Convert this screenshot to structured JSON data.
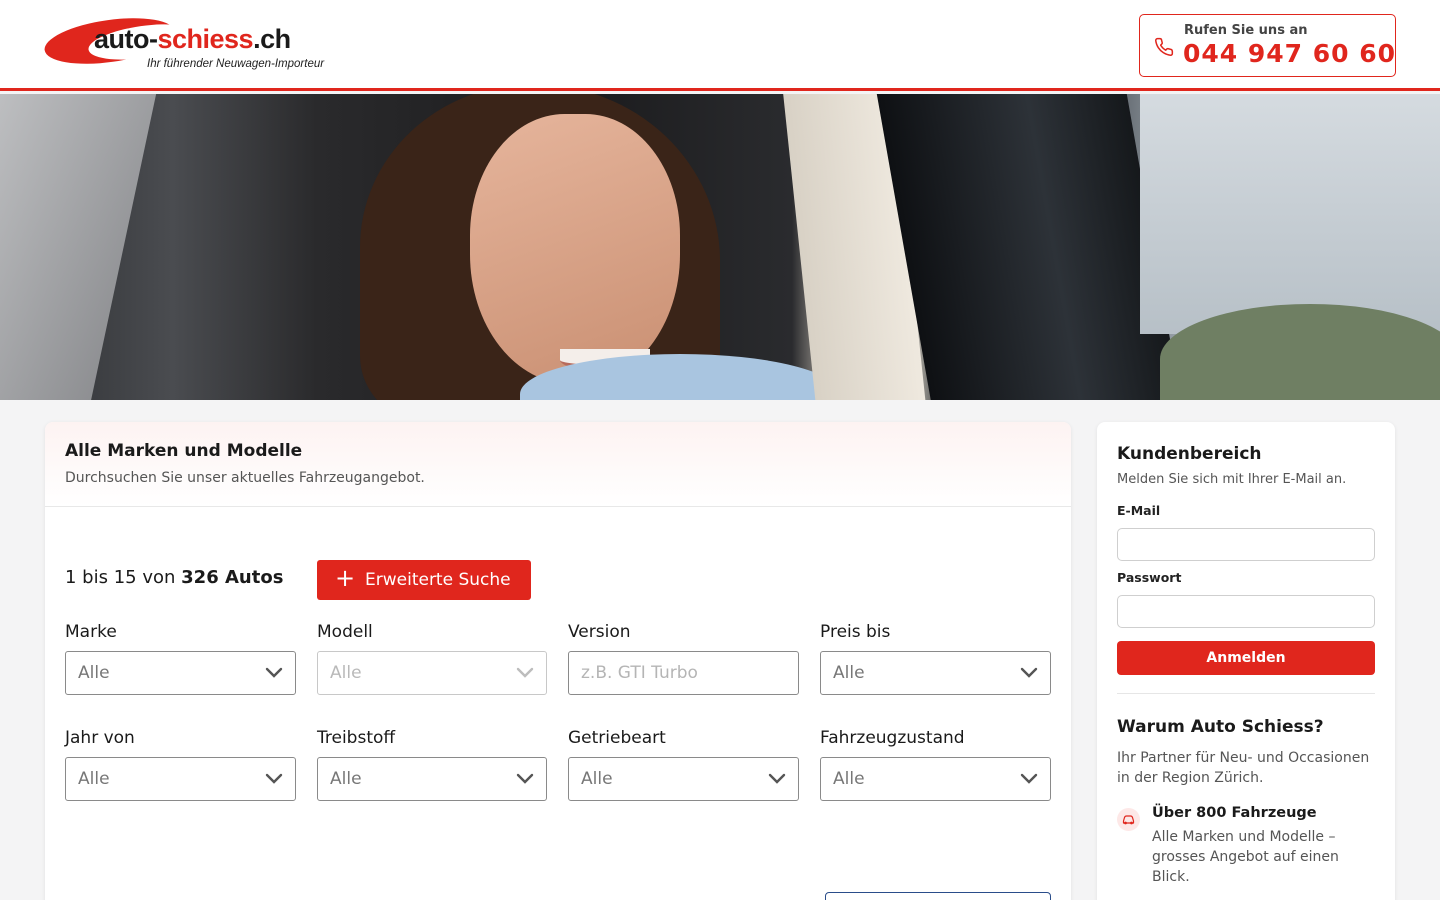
{
  "header": {
    "logo_text_main": "auto-",
    "logo_text_accent": "schiess",
    "logo_text_tld": ".ch",
    "logo_tagline": "Ihr führender Neuwagen-Importeur",
    "call_label": "Rufen Sie uns an",
    "call_number": "044 947 60 60",
    "call_icon": "phone-icon"
  },
  "colors": {
    "accent": "#e0261d",
    "text": "#1a1a1a",
    "muted": "#555555",
    "page_bg": "#f4f4f5"
  },
  "search": {
    "title": "Alle Marken und Modelle",
    "subtitle": "Durchsuchen Sie unser aktuelles Fahrzeugangebot.",
    "count_prefix": "1 bis 15 von",
    "count_bold": "326 Autos",
    "advanced_label": "Erweiterte Suche",
    "advanced_icon": "plus-icon",
    "filters": [
      {
        "label": "Marke",
        "value": "Alle",
        "type": "select",
        "disabled": false
      },
      {
        "label": "Modell",
        "value": "Alle",
        "type": "select",
        "disabled": true
      },
      {
        "label": "Version",
        "value": "",
        "placeholder": "z.B. GTI Turbo",
        "type": "text",
        "disabled": false
      },
      {
        "label": "Preis bis",
        "value": "Alle",
        "type": "select",
        "disabled": false
      },
      {
        "label": "Jahr von",
        "value": "Alle",
        "type": "select",
        "disabled": false
      },
      {
        "label": "Treibstoff",
        "value": "Alle",
        "type": "select",
        "disabled": false
      },
      {
        "label": "Getriebeart",
        "value": "Alle",
        "type": "select",
        "disabled": false
      },
      {
        "label": "Fahrzeugzustand",
        "value": "Alle",
        "type": "select",
        "disabled": false
      }
    ]
  },
  "customer": {
    "title": "Kundenbereich",
    "subtitle": "Melden Sie sich mit Ihrer E-Mail an.",
    "email_label": "E-Mail",
    "email_value": "",
    "password_label": "Passwort",
    "password_value": "",
    "login_label": "Anmelden",
    "why_title": "Warum Auto Schiess?",
    "why_text": "Ihr Partner für Neu- und Occasionen in der Region Zürich.",
    "feature_icon": "car-icon",
    "feature_title": "Über 800 Fahrzeuge",
    "feature_text": "Alle Marken und Modelle – grosses Angebot auf einen Blick."
  }
}
